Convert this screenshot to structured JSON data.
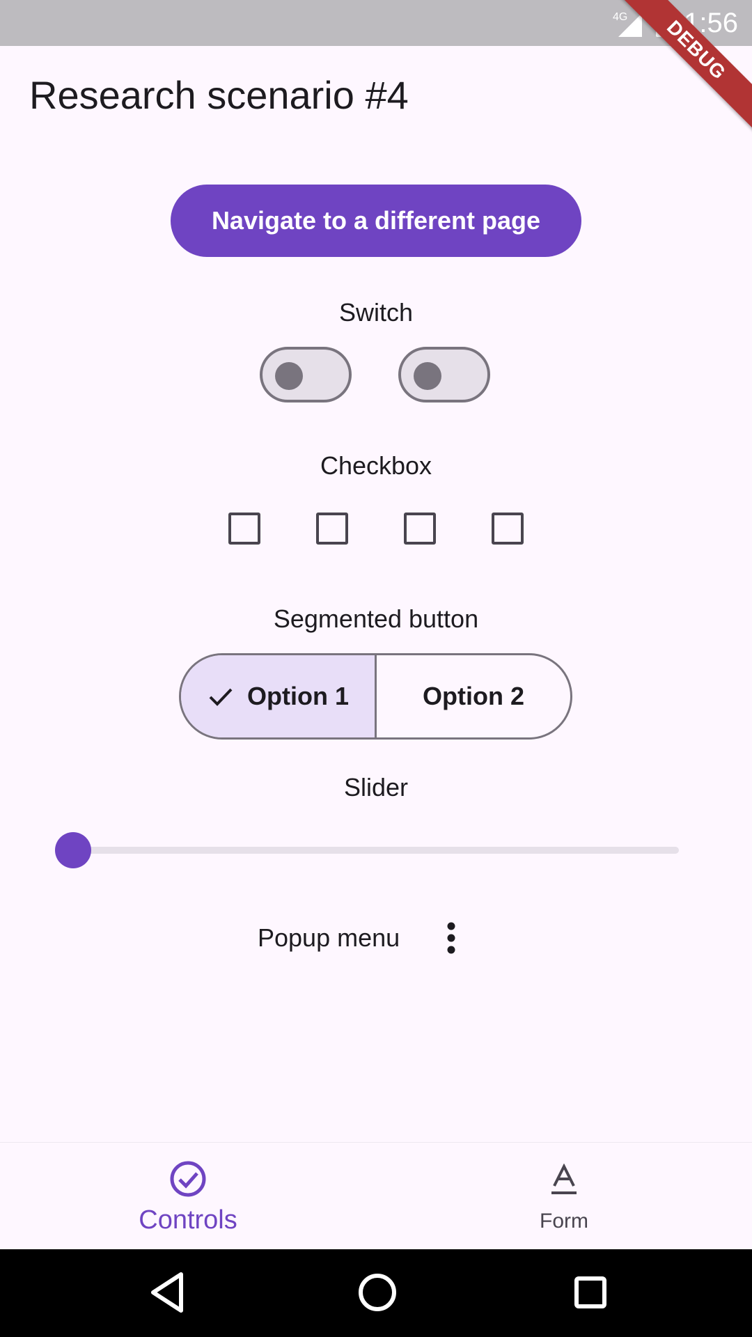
{
  "status_bar": {
    "time": "1:56",
    "network": "4G",
    "icons": [
      "signal-icon",
      "battery-charging-icon"
    ]
  },
  "debug_banner": "DEBUG",
  "app": {
    "title": "Research scenario #4",
    "accent_color": "#6f44c2"
  },
  "navigate_button": {
    "label": "Navigate to a different page"
  },
  "switch_section": {
    "label": "Switch",
    "switches": [
      {
        "on": false
      },
      {
        "on": false
      }
    ]
  },
  "checkbox_section": {
    "label": "Checkbox",
    "checkboxes": [
      {
        "checked": false
      },
      {
        "checked": false
      },
      {
        "checked": false
      },
      {
        "checked": false
      }
    ]
  },
  "segmented_section": {
    "label": "Segmented button",
    "options": [
      {
        "label": "Option 1",
        "selected": true
      },
      {
        "label": "Option 2",
        "selected": false
      }
    ]
  },
  "slider_section": {
    "label": "Slider",
    "value_fraction": 0.0
  },
  "popup_section": {
    "label": "Popup menu",
    "icon": "more-vert-icon"
  },
  "bottom_nav": {
    "items": [
      {
        "label": "Controls",
        "icon": "check-circle-icon",
        "active": true
      },
      {
        "label": "Form",
        "icon": "text-format-icon",
        "active": false
      }
    ]
  },
  "system_nav": {
    "icons": [
      "back-icon",
      "home-icon",
      "recents-icon"
    ]
  }
}
